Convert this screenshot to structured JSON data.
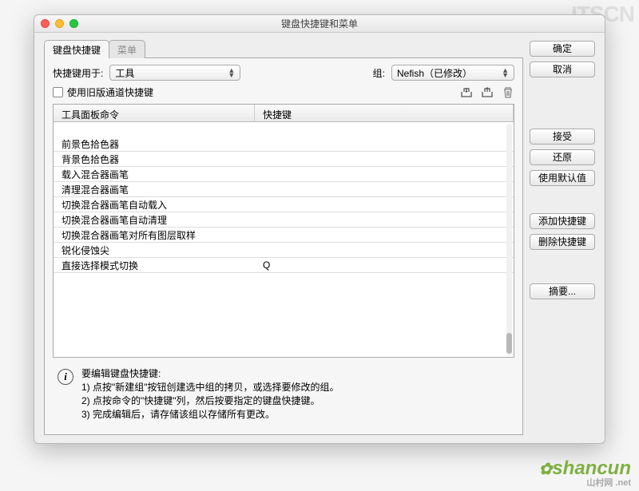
{
  "window": {
    "title": "键盘快捷键和菜单"
  },
  "tabs": {
    "t1": "键盘快捷键",
    "t2": "菜单"
  },
  "top": {
    "shortcuts_for_label": "快捷键用于:",
    "shortcuts_for_value": "工具",
    "set_label": "组:",
    "set_value": "Nefish（已修改）",
    "legacy_checkbox": "使用旧版通道快捷键"
  },
  "table": {
    "col1": "工具面板命令",
    "col2": "快捷键",
    "rows": [
      {
        "cmd": "前景色拾色器",
        "key": ""
      },
      {
        "cmd": "背景色拾色器",
        "key": ""
      },
      {
        "cmd": "载入混合器画笔",
        "key": ""
      },
      {
        "cmd": "清理混合器画笔",
        "key": ""
      },
      {
        "cmd": "切换混合器画笔自动载入",
        "key": ""
      },
      {
        "cmd": "切换混合器画笔自动清理",
        "key": ""
      },
      {
        "cmd": "切换混合器画笔对所有图层取样",
        "key": ""
      },
      {
        "cmd": "锐化侵蚀尖",
        "key": ""
      },
      {
        "cmd": "直接选择模式切换",
        "key": "Q"
      }
    ]
  },
  "buttons": {
    "ok": "确定",
    "cancel": "取消",
    "accept": "接受",
    "undo": "还原",
    "defaults": "使用默认值",
    "add": "添加快捷键",
    "delete": "删除快捷键",
    "summary": "摘要..."
  },
  "help": {
    "title": "要编辑键盘快捷键:",
    "l1": "1) 点按\"新建组\"按钮创建选中组的拷贝，或选择要修改的组。",
    "l2": "2) 点按命令的\"快捷键\"列，然后按要指定的键盘快捷键。",
    "l3": "3) 完成编辑后，请存储该组以存储所有更改。"
  },
  "watermark": {
    "top": "ITSCN",
    "bot": "shancun",
    "net": "山村网 .net"
  }
}
